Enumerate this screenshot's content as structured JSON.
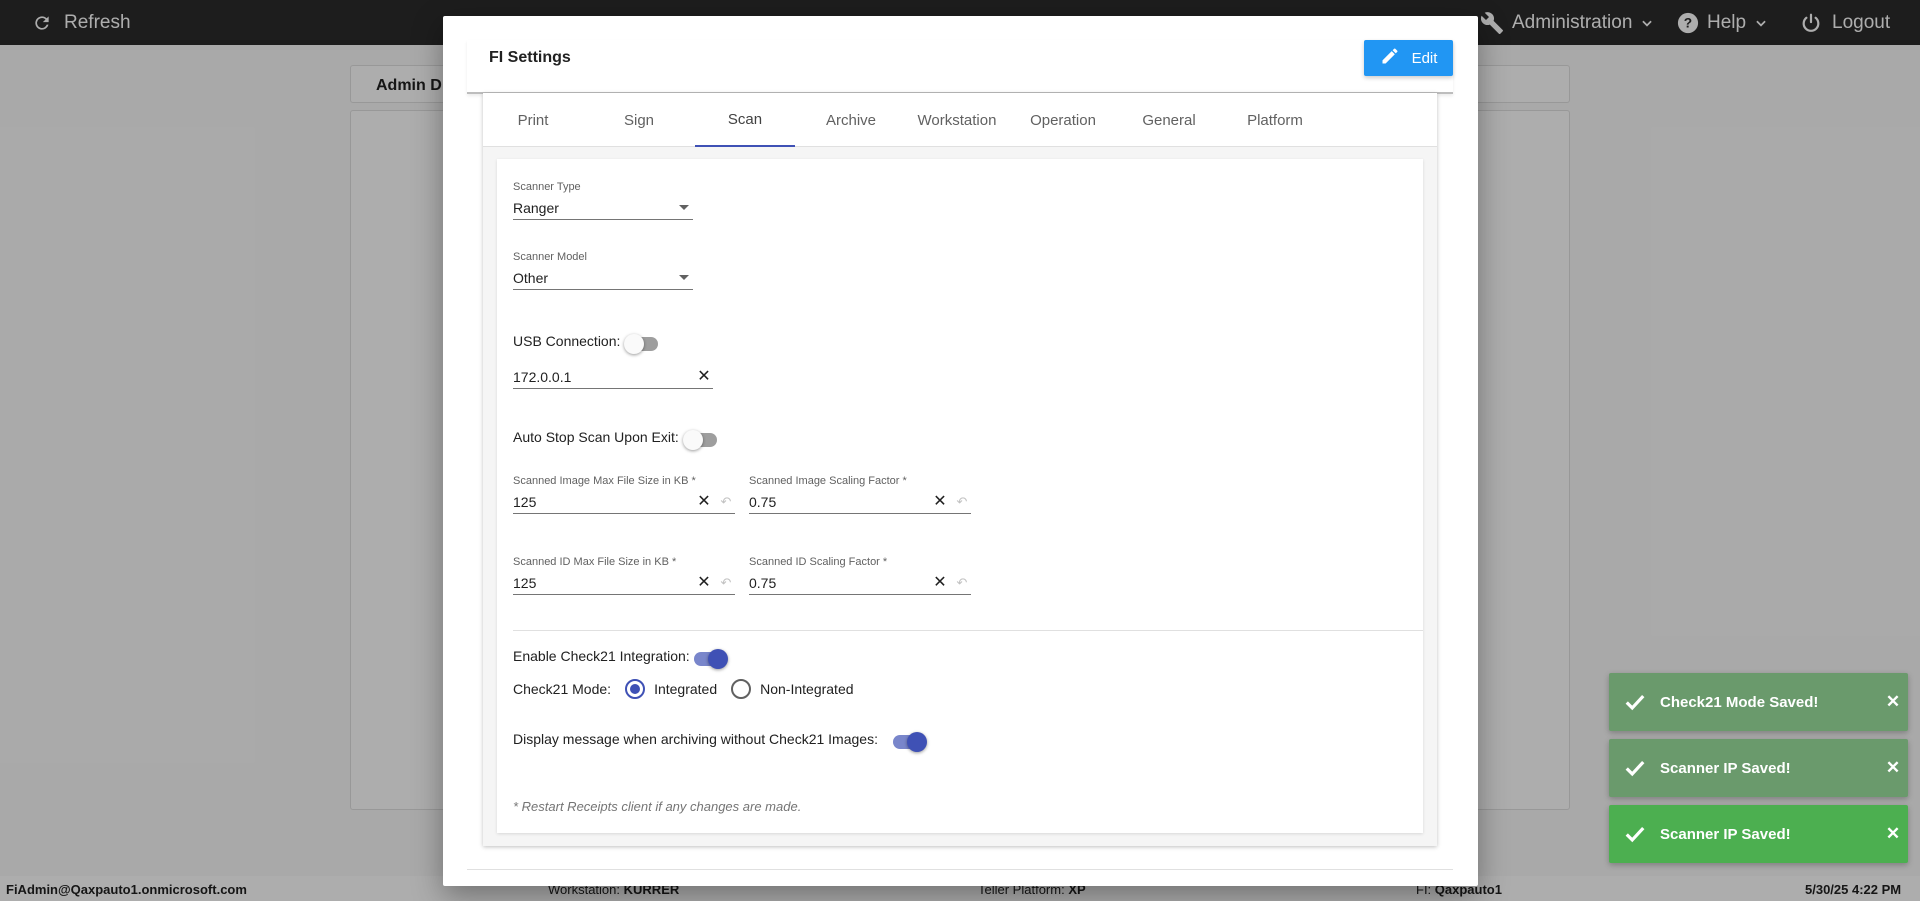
{
  "topbar": {
    "refresh_label": "Refresh",
    "administration_label": "Administration",
    "help_label": "Help",
    "logout_label": "Logout"
  },
  "background": {
    "card_title": "Admin D"
  },
  "status_bar": {
    "user": "FiAdmin@Qaxpauto1.onmicrosoft.com",
    "workstation_label": "Workstation:",
    "workstation_value": "KURRER",
    "teller_platform_label": "Teller Platform:",
    "teller_platform_value": "XP",
    "fi_label": "FI:",
    "fi_value": "Qaxpauto1",
    "datetime": "5/30/25 4:22 PM"
  },
  "modal": {
    "title": "FI Settings",
    "edit_label": "Edit",
    "tabs": [
      {
        "label": "Print",
        "active": false
      },
      {
        "label": "Sign",
        "active": false
      },
      {
        "label": "Scan",
        "active": true
      },
      {
        "label": "Archive",
        "active": false
      },
      {
        "label": "Workstation",
        "active": false
      },
      {
        "label": "Operation",
        "active": false
      },
      {
        "label": "General",
        "active": false
      },
      {
        "label": "Platform",
        "active": false
      }
    ],
    "scan": {
      "scanner_type_label": "Scanner Type",
      "scanner_type_value": "Ranger",
      "scanner_model_label": "Scanner Model",
      "scanner_model_value": "Other",
      "usb_connection_label": "USB Connection:",
      "usb_connection_on": false,
      "ip_address": "172.0.0.1",
      "auto_stop_label": "Auto Stop Scan Upon Exit:",
      "auto_stop_on": false,
      "image_max_size_label": "Scanned Image Max File Size in KB *",
      "image_max_size_value": "125",
      "image_scaling_label": "Scanned Image Scaling Factor *",
      "image_scaling_value": "0.75",
      "id_max_size_label": "Scanned ID Max File Size in KB *",
      "id_max_size_value": "125",
      "id_scaling_label": "Scanned ID Scaling Factor *",
      "id_scaling_value": "0.75",
      "check21_label": "Enable Check21 Integration:",
      "check21_on": true,
      "check21_mode_label": "Check21 Mode:",
      "check21_mode_options": [
        "Integrated",
        "Non-Integrated"
      ],
      "check21_mode_selected": "Integrated",
      "display_message_label": "Display message when archiving without Check21 Images:",
      "display_message_on": true,
      "restart_note": "* Restart Receipts client if any changes are made."
    }
  },
  "toasts": [
    {
      "message": "Check21 Mode Saved!",
      "style": "faded"
    },
    {
      "message": "Scanner IP Saved!",
      "style": "faded"
    },
    {
      "message": "Scanner IP Saved!",
      "style": "bright"
    }
  ],
  "colors": {
    "primary": "#3f51b5",
    "edit_button": "#2196f3",
    "toast_success": "#4caf50",
    "topbar": "#2b2b2b"
  }
}
